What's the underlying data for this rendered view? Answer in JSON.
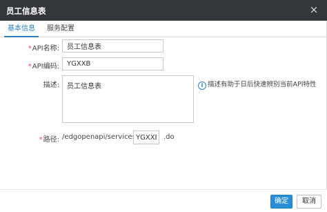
{
  "dialog": {
    "title": "员工信息表",
    "close_glyph": "×"
  },
  "tabs": [
    {
      "label": "基本信息",
      "active": true
    },
    {
      "label": "服务配置",
      "active": false
    }
  ],
  "form": {
    "api_name": {
      "required_mark": "*",
      "label": "API名称:",
      "value": "员工信息表"
    },
    "api_code": {
      "required_mark": "*",
      "label": "API编码:",
      "value": "YGXXB"
    },
    "description": {
      "label": "描述:",
      "value": "员工信息表"
    },
    "path": {
      "required_mark": "*",
      "label": "路径:",
      "prefix": "/edgopenapi/services/",
      "value": "YGXXB",
      "suffix": ".do"
    }
  },
  "hint": {
    "icon": "info-icon",
    "text": "描述有助于日后快速辨别当前API特性"
  },
  "footer": {
    "ok_label": "确定",
    "cancel_label": "取消"
  },
  "colors": {
    "titlebar": "#33373b",
    "accent": "#2a7db8",
    "primary_button": "#2a8fd4",
    "required": "#e04040"
  }
}
